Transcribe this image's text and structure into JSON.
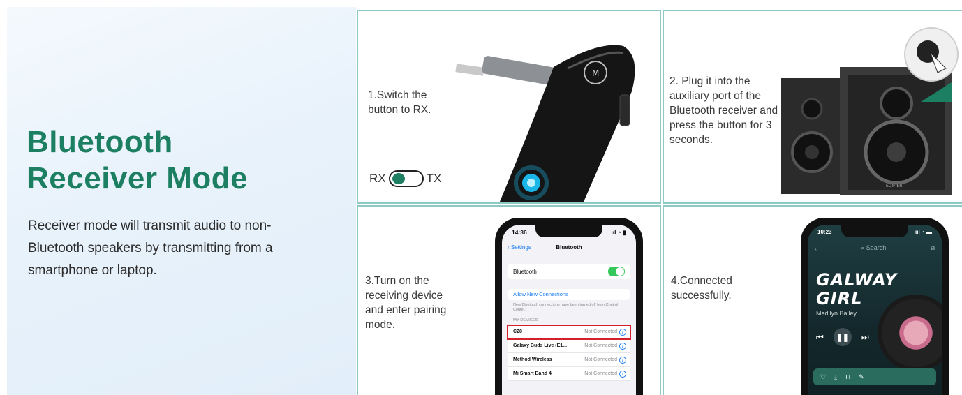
{
  "hero": {
    "title_line1": "Bluetooth",
    "title_line2": "Receiver Mode",
    "description": "Receiver mode will transmit audio to non-Bluetooth speakers by transmitting from a smartphone or laptop."
  },
  "steps": [
    {
      "text": "1.Switch the button to RX."
    },
    {
      "text": "2. Plug it into the auxiliary port of the Bluetooth receiver and press the button for 3 seconds."
    },
    {
      "text": "3.Turn on the receiving device and enter pairing mode."
    },
    {
      "text": "4.Connected successfully."
    }
  ],
  "switch": {
    "left_label": "RX",
    "right_label": "TX",
    "selected": "RX"
  },
  "speakers": {
    "brand": "EDIFIER"
  },
  "adapter": {
    "logo": "M"
  },
  "ios": {
    "time": "14:36",
    "back_label": "Settings",
    "nav_title": "Bluetooth",
    "bluetooth_label": "Bluetooth",
    "allow_label": "Allow New Connections",
    "note": "New Bluetooth connections have been turned off from Control Center.",
    "section_label": "MY DEVICES",
    "devices": [
      {
        "name": "C28",
        "status": "Not Connected"
      },
      {
        "name": "Galaxy Buds Live (E1...",
        "status": "Not Connected"
      },
      {
        "name": "Method Wireless",
        "status": "Not Connected"
      },
      {
        "name": "Mi Smart Band 4",
        "status": "Not Connected"
      }
    ]
  },
  "music": {
    "time": "10:23",
    "search_placeholder": "Search",
    "song_line1": "GALWAY",
    "song_line2": "GIRL",
    "artist": "Madilyn Bailey"
  },
  "colors": {
    "accent_green": "#1d7f62",
    "border_teal": "#8ec9c6",
    "highlight_red": "#d3202a"
  }
}
